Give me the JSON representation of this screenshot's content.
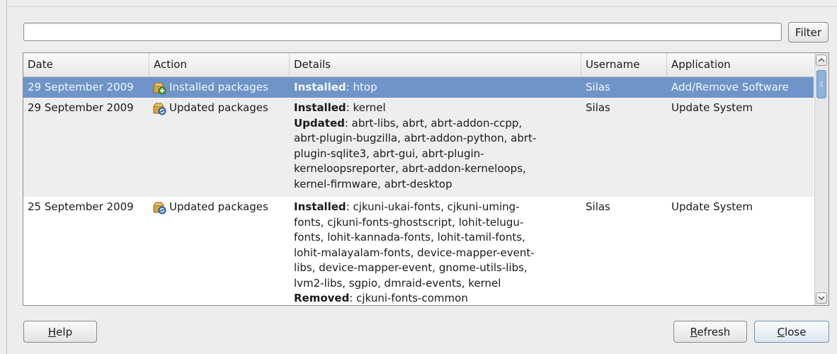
{
  "filter": {
    "value": "",
    "button_label": "Filter"
  },
  "table": {
    "columns": {
      "date": "Date",
      "action": "Action",
      "details": "Details",
      "username": "Username",
      "application": "Application"
    },
    "rows": [
      {
        "date": "29 September 2009",
        "action": "Installed packages",
        "action_icon": "install-packages-icon",
        "details": [
          {
            "label": "Installed",
            "text": ": htop"
          }
        ],
        "username": "Silas",
        "application": "Add/Remove Software",
        "selected": true
      },
      {
        "date": "29 September 2009",
        "action": "Updated packages",
        "action_icon": "update-packages-icon",
        "details": [
          {
            "label": "Installed",
            "text": ": kernel"
          },
          {
            "label": "Updated",
            "text": ": abrt-libs, abrt, abrt-addon-ccpp,"
          },
          {
            "label": "",
            "text": "abrt-plugin-bugzilla, abrt-addon-python, abrt-"
          },
          {
            "label": "",
            "text": "plugin-sqlite3, abrt-gui, abrt-plugin-"
          },
          {
            "label": "",
            "text": "kerneloopsreporter, abrt-addon-kerneloops,"
          },
          {
            "label": "",
            "text": "kernel-firmware, abrt-desktop"
          }
        ],
        "username": "Silas",
        "application": "Update System",
        "selected": false
      },
      {
        "date": "25 September 2009",
        "action": "Updated packages",
        "action_icon": "update-packages-icon",
        "details": [
          {
            "label": "Installed",
            "text": ": cjkuni-ukai-fonts, cjkuni-uming-"
          },
          {
            "label": "",
            "text": "fonts, cjkuni-fonts-ghostscript, lohit-telugu-"
          },
          {
            "label": "",
            "text": "fonts, lohit-kannada-fonts, lohit-tamil-fonts,"
          },
          {
            "label": "",
            "text": "lohit-malayalam-fonts, device-mapper-event-"
          },
          {
            "label": "",
            "text": "libs, device-mapper-event, gnome-utils-libs,"
          },
          {
            "label": "",
            "text": "lvm2-libs, sgpio, dmraid-events, kernel"
          },
          {
            "label": "Removed",
            "text": ": cjkuni-fonts-common"
          }
        ],
        "username": "Silas",
        "application": "Update System",
        "selected": false
      }
    ]
  },
  "buttons": {
    "help": {
      "mnemonic": "H",
      "rest": "elp"
    },
    "refresh": {
      "mnemonic": "R",
      "rest": "efresh"
    },
    "close": {
      "mnemonic": "C",
      "rest": "lose"
    }
  },
  "colors": {
    "selection": "#6e94c8",
    "row_alt": "#eeeeee",
    "window_bg": "#ededed"
  }
}
